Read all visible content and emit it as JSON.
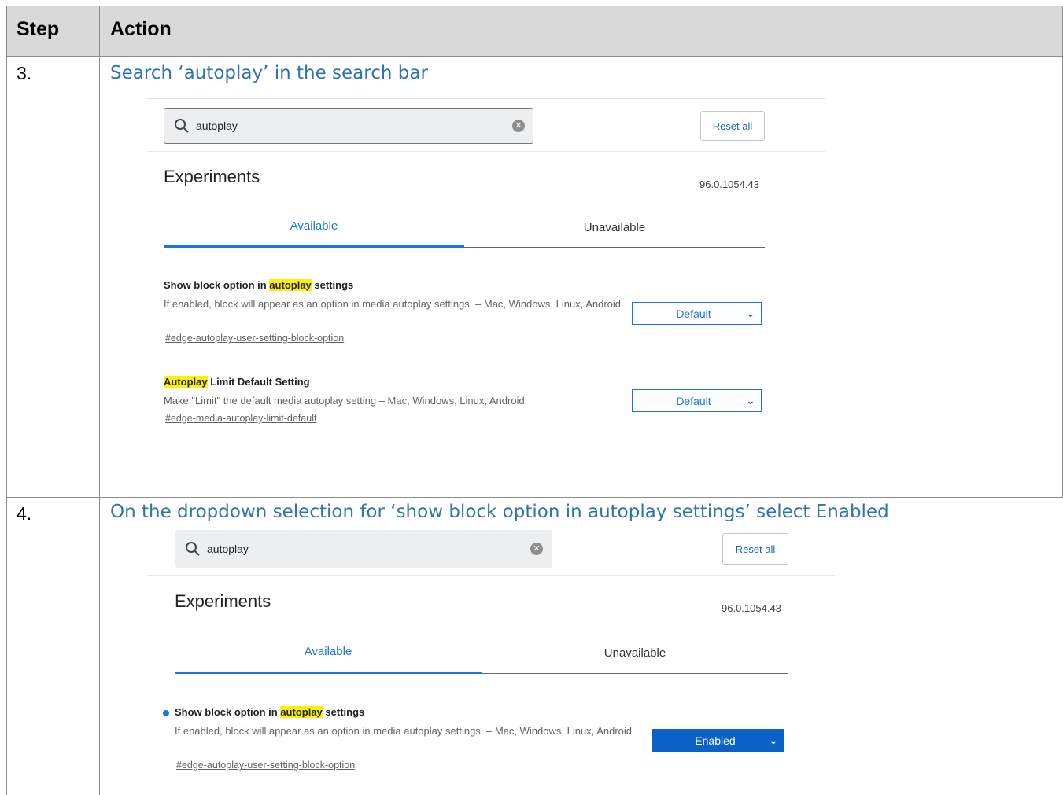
{
  "table": {
    "header": {
      "step": "Step",
      "action": "Action"
    },
    "rows": [
      {
        "step": "3.",
        "instruction": "Search ‘autoplay’ in the search bar",
        "screenshot": {
          "search_query": "autoplay",
          "reset_label": "Reset all",
          "title": "Experiments",
          "version": "96.0.1054.43",
          "tabs": [
            "Available",
            "Unavailable"
          ],
          "flags": [
            {
              "title_before": "Show block option in ",
              "title_highlight": "autoplay",
              "title_after": " settings",
              "description": "If enabled, block will appear as an option in media autoplay settings. – Mac, Windows, Linux, Android",
              "link": "#edge-autoplay-user-setting-block-option",
              "select_value": "Default"
            },
            {
              "title_before": "",
              "title_highlight": "Autoplay",
              "title_after": " Limit Default Setting",
              "description": "Make \"Limit\" the default media autoplay setting – Mac, Windows, Linux, Android",
              "link": "#edge-media-autoplay-limit-default",
              "select_value": "Default"
            }
          ]
        }
      },
      {
        "step": "4.",
        "instruction": "On the dropdown selection for ‘show block option in autoplay settings’ select Enabled",
        "screenshot": {
          "search_query": "autoplay",
          "reset_label": "Reset all",
          "title": "Experiments",
          "version": "96.0.1054.43",
          "tabs": [
            "Available",
            "Unavailable"
          ],
          "flags": [
            {
              "title_before": "Show block option in ",
              "title_highlight": "autoplay",
              "title_after": " settings",
              "description": "If enabled, block will appear as an option in media autoplay settings. – Mac, Windows, Linux, Android",
              "link": "#edge-autoplay-user-setting-block-option",
              "select_value": "Enabled"
            }
          ]
        }
      }
    ]
  },
  "colors": {
    "instruction_text": "#2e74b5",
    "header_bg": "#d9d9d9",
    "highlight": "#fff200",
    "accent_blue": "#1a73e8",
    "enabled_select_bg": "#0a62c9"
  },
  "icons": [
    "search-icon",
    "clear-search-icon",
    "chevron-down-icon",
    "modified-flag-dot-icon"
  ]
}
